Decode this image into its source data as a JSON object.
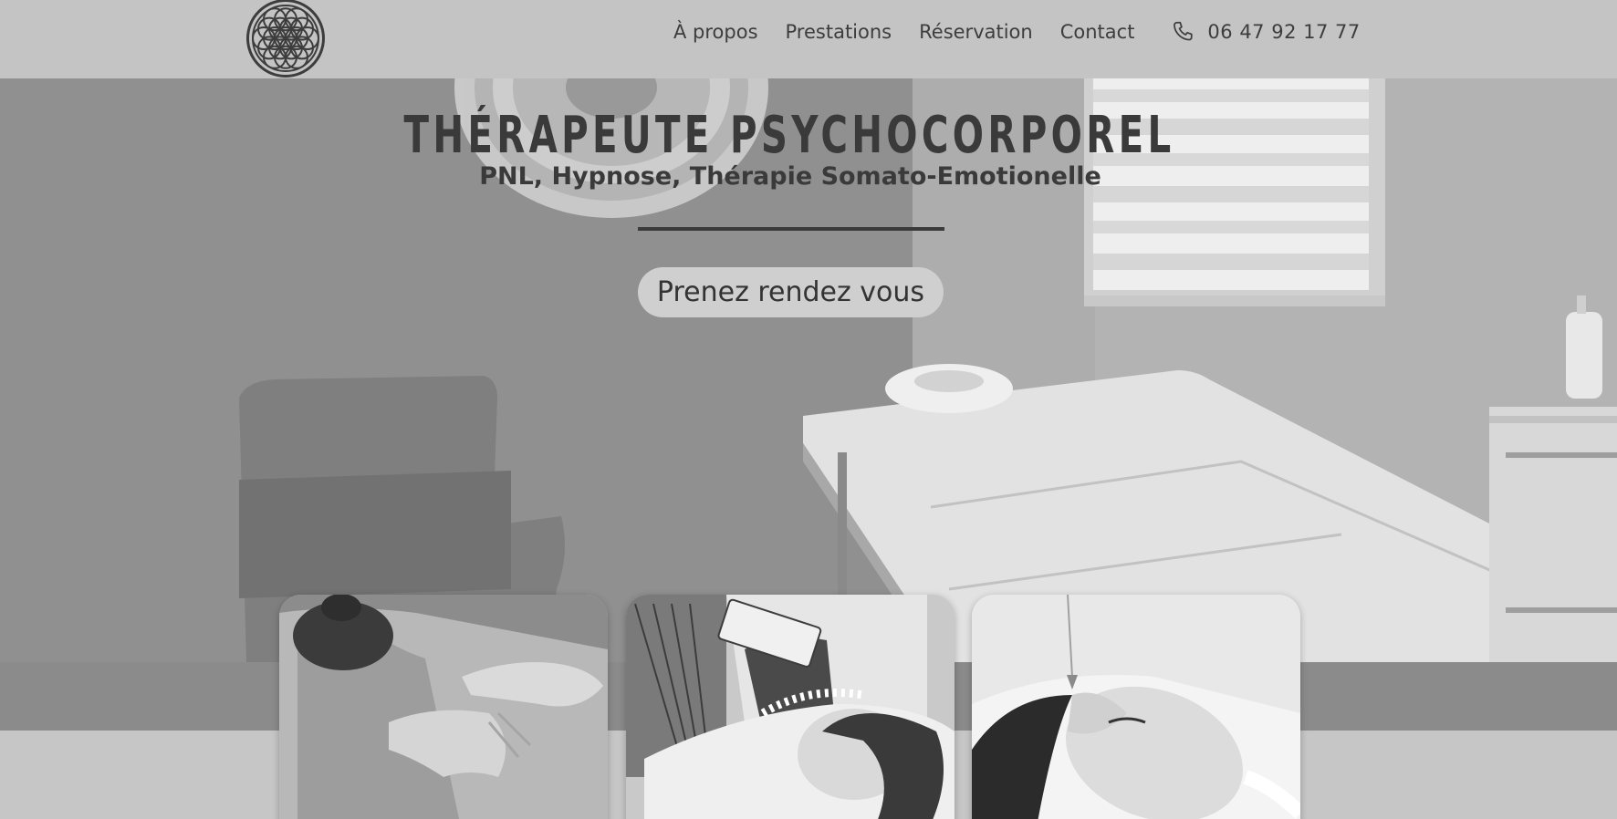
{
  "header": {
    "logo_icon": "flower-of-life-logo-icon",
    "nav": [
      {
        "label": "À propos"
      },
      {
        "label": "Prestations"
      },
      {
        "label": "Réservation"
      },
      {
        "label": "Contact"
      }
    ],
    "phone_icon": "phone-icon",
    "phone_number": "06 47 92 17 77"
  },
  "hero": {
    "title": "THÉRAPEUTE PSYCHOCORPOREL",
    "subtitle": "PNL, Hypnose, Thérapie Somato-Emotionelle",
    "cta_label": "Prenez rendez vous"
  },
  "cards": [
    {
      "icon": "massage-photo"
    },
    {
      "icon": "hypnosis-session-photo"
    },
    {
      "icon": "pendulum-therapy-photo"
    }
  ],
  "colors": {
    "text": "#3a3a3a",
    "header_bg": "#c4c4c4",
    "button_bg": "#cfcfcf"
  }
}
